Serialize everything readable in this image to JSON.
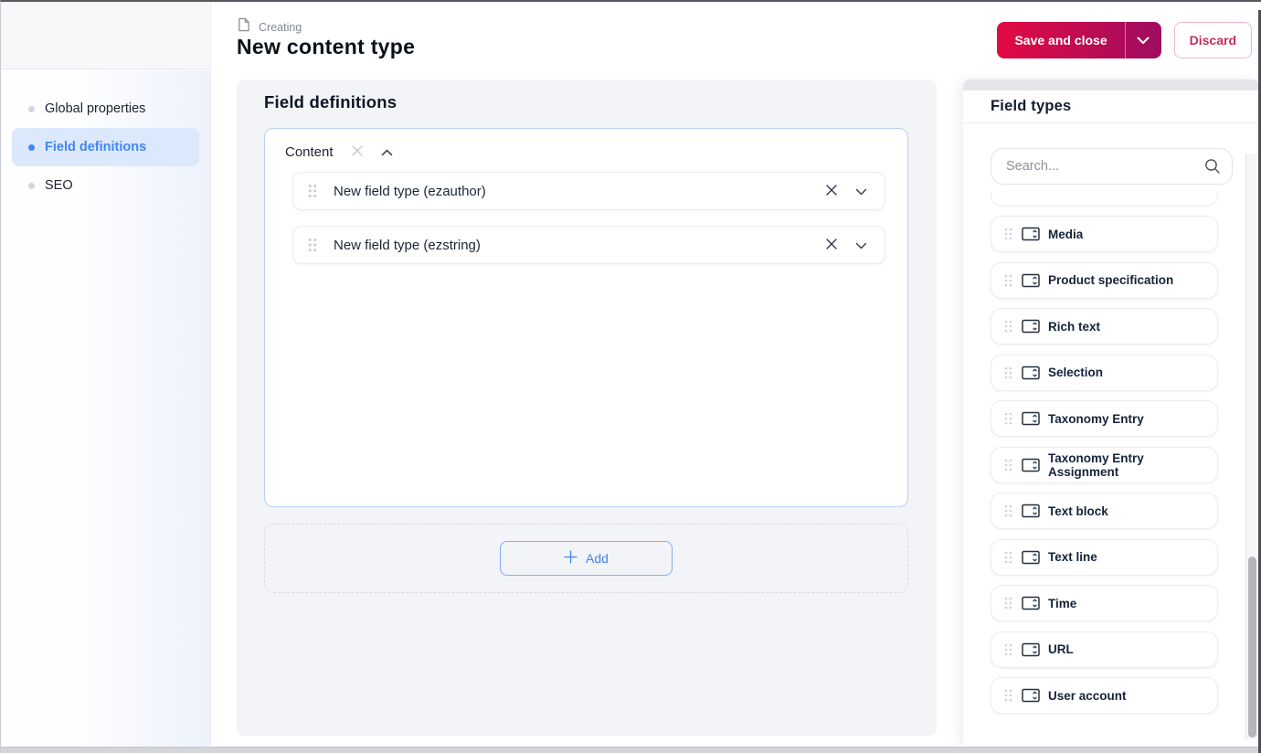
{
  "header": {
    "kicker": "Creating",
    "title": "New content type",
    "save_button": "Save and close",
    "discard_button": "Discard"
  },
  "sidebar": {
    "items": [
      {
        "label": "Global properties",
        "active": false
      },
      {
        "label": "Field definitions",
        "active": true
      },
      {
        "label": "SEO",
        "active": false
      }
    ]
  },
  "main": {
    "section_title": "Field definitions",
    "group": {
      "title": "Content",
      "fields": [
        {
          "label": "New field type (ezauthor)"
        },
        {
          "label": "New field type (ezstring)"
        }
      ]
    },
    "add_button": "Add"
  },
  "field_types_panel": {
    "title": "Field types",
    "search_placeholder": "Search...",
    "items": [
      "Media",
      "Product specification",
      "Rich text",
      "Selection",
      "Taxonomy Entry",
      "Taxonomy Entry Assignment",
      "Text block",
      "Text line",
      "Time",
      "URL",
      "User account"
    ]
  },
  "icons": {
    "document": "document-outline",
    "chevron_down": "chevron-down",
    "chevron_up": "chevron-up",
    "close": "x-cross",
    "plus": "plus",
    "search": "magnifier",
    "drag": "six-dot-grid",
    "field_type": "input-stepper-rect"
  },
  "colors": {
    "primary_gradient_start": "#e30a42",
    "primary_gradient_end": "#9e0d61",
    "accent_blue": "#4285f4",
    "active_nav_bg": "#dce9fc",
    "panel_gray": "#f3f4f7",
    "group_border_blue": "#b7d0f6",
    "discard_text": "#c62f5d",
    "discard_border": "#f2b7ca",
    "text_dark": "#0c1118",
    "text_muted": "#83878f"
  }
}
